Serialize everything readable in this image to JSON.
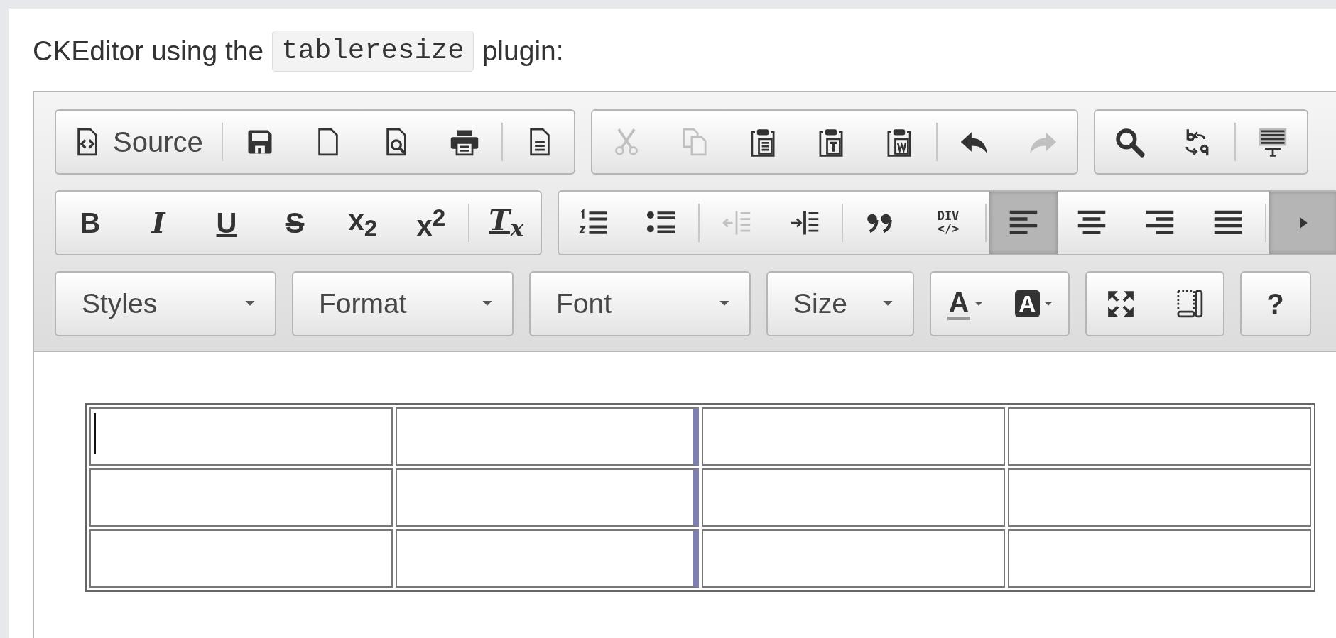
{
  "caption": {
    "before": "CKEditor using the",
    "code": "tableresize",
    "after": "plugin:"
  },
  "toolbar": [
    {
      "groups": [
        {
          "sections": [
            [
              {
                "kind": "icon_label",
                "label": "Source",
                "disabled": false,
                "on": false
              }
            ],
            [
              {
                "kind": "icon",
                "disabled": false,
                "on": false
              },
              {
                "kind": "icon",
                "disabled": false,
                "on": false
              },
              {
                "kind": "icon",
                "disabled": false,
                "on": false
              },
              {
                "kind": "icon",
                "disabled": false,
                "on": false
              }
            ],
            [
              {
                "kind": "icon",
                "disabled": false,
                "on": false
              }
            ]
          ]
        },
        {
          "sections": [
            [
              {
                "kind": "icon",
                "disabled": true,
                "on": false
              },
              {
                "kind": "icon",
                "disabled": true,
                "on": false
              },
              {
                "kind": "icon",
                "disabled": false,
                "on": false
              },
              {
                "kind": "icon",
                "disabled": false,
                "on": false
              },
              {
                "kind": "icon",
                "disabled": false,
                "on": false
              }
            ],
            [
              {
                "kind": "icon",
                "disabled": false,
                "on": false
              },
              {
                "kind": "icon",
                "disabled": true,
                "on": false
              }
            ]
          ]
        },
        {
          "sections": [
            [
              {
                "kind": "icon",
                "disabled": false,
                "on": false
              },
              {
                "kind": "icon",
                "disabled": false,
                "on": false
              }
            ],
            [
              {
                "kind": "icon",
                "disabled": false,
                "on": false
              }
            ]
          ]
        }
      ]
    },
    {
      "groups": [
        {
          "sections": [
            [
              {
                "kind": "glyph",
                "label": "B",
                "disabled": false,
                "on": false
              },
              {
                "kind": "glyph",
                "label": "I",
                "disabled": false,
                "on": false
              },
              {
                "kind": "glyph",
                "label": "U",
                "disabled": false,
                "on": false
              },
              {
                "kind": "glyph",
                "label": "S",
                "disabled": false,
                "on": false
              },
              {
                "kind": "glyph",
                "label": "x$_{2}$",
                "disabled": false,
                "on": false
              },
              {
                "kind": "glyph",
                "label": "x$^{2}$",
                "disabled": false,
                "on": false
              }
            ],
            [
              {
                "kind": "glyph",
                "label": "T$_{x}$",
                "disabled": false,
                "on": false
              }
            ]
          ]
        },
        {
          "sections": [
            [
              {
                "kind": "icon",
                "disabled": false,
                "on": false
              },
              {
                "kind": "icon",
                "disabled": false,
                "on": false
              }
            ],
            [
              {
                "kind": "icon",
                "disabled": true,
                "on": false
              },
              {
                "kind": "icon",
                "disabled": false,
                "on": false
              }
            ],
            [
              {
                "kind": "icon",
                "disabled": false,
                "on": false
              },
              {
                "kind": "stack",
                "label": "DIV",
                "sublabel": "</>",
                "disabled": false,
                "on": false
              }
            ],
            [
              {
                "kind": "icon",
                "disabled": false,
                "on": true
              },
              {
                "kind": "icon",
                "disabled": false,
                "on": false
              },
              {
                "kind": "icon",
                "disabled": false,
                "on": false
              },
              {
                "kind": "icon",
                "disabled": false,
                "on": false
              }
            ],
            [
              {
                "kind": "icon",
                "disabled": false,
                "on": true
              }
            ]
          ]
        }
      ]
    },
    {
      "groups": [
        {
          "combo": "Styles"
        },
        {
          "combo": "Format"
        },
        {
          "combo": "Font"
        },
        {
          "combo": "Size"
        },
        {
          "sections": [
            [
              {
                "kind": "color",
                "label": "A",
                "disabled": false,
                "on": false
              },
              {
                "kind": "bgcolor",
                "label": "A",
                "disabled": false,
                "on": false
              }
            ]
          ]
        },
        {
          "sections": [
            [
              {
                "kind": "icon",
                "disabled": false,
                "on": false
              },
              {
                "kind": "icon",
                "disabled": false,
                "on": false
              }
            ]
          ]
        },
        {
          "sections": [
            [
              {
                "kind": "glyph",
                "label": "?",
                "disabled": false,
                "on": false
              }
            ]
          ]
        }
      ]
    }
  ],
  "table": {
    "columns": [
      {
        "resize_handle": false
      },
      {
        "resize_handle": true
      },
      {
        "resize_handle": false
      },
      {
        "resize_handle": false
      }
    ],
    "rows": [
      {
        "cells": [
          {
            "caret": true
          },
          {
            "caret": false
          },
          {
            "caret": false
          },
          {
            "caret": false
          }
        ]
      },
      {
        "cells": [
          {
            "caret": false
          },
          {
            "caret": false
          },
          {
            "caret": false
          },
          {
            "caret": false
          }
        ]
      },
      {
        "cells": [
          {
            "caret": false
          },
          {
            "caret": false
          },
          {
            "caret": false
          },
          {
            "caret": false
          }
        ]
      }
    ]
  }
}
